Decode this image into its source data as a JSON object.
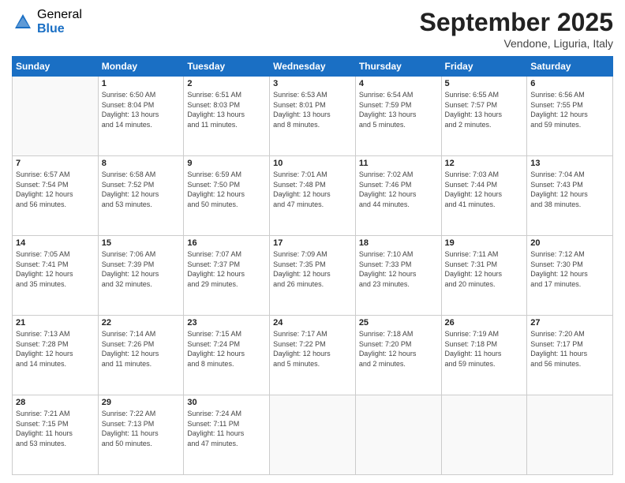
{
  "header": {
    "logo_general": "General",
    "logo_blue": "Blue",
    "month_title": "September 2025",
    "location": "Vendone, Liguria, Italy"
  },
  "days_of_week": [
    "Sunday",
    "Monday",
    "Tuesday",
    "Wednesday",
    "Thursday",
    "Friday",
    "Saturday"
  ],
  "weeks": [
    [
      {
        "day": "",
        "info": ""
      },
      {
        "day": "1",
        "info": "Sunrise: 6:50 AM\nSunset: 8:04 PM\nDaylight: 13 hours\nand 14 minutes."
      },
      {
        "day": "2",
        "info": "Sunrise: 6:51 AM\nSunset: 8:03 PM\nDaylight: 13 hours\nand 11 minutes."
      },
      {
        "day": "3",
        "info": "Sunrise: 6:53 AM\nSunset: 8:01 PM\nDaylight: 13 hours\nand 8 minutes."
      },
      {
        "day": "4",
        "info": "Sunrise: 6:54 AM\nSunset: 7:59 PM\nDaylight: 13 hours\nand 5 minutes."
      },
      {
        "day": "5",
        "info": "Sunrise: 6:55 AM\nSunset: 7:57 PM\nDaylight: 13 hours\nand 2 minutes."
      },
      {
        "day": "6",
        "info": "Sunrise: 6:56 AM\nSunset: 7:55 PM\nDaylight: 12 hours\nand 59 minutes."
      }
    ],
    [
      {
        "day": "7",
        "info": "Sunrise: 6:57 AM\nSunset: 7:54 PM\nDaylight: 12 hours\nand 56 minutes."
      },
      {
        "day": "8",
        "info": "Sunrise: 6:58 AM\nSunset: 7:52 PM\nDaylight: 12 hours\nand 53 minutes."
      },
      {
        "day": "9",
        "info": "Sunrise: 6:59 AM\nSunset: 7:50 PM\nDaylight: 12 hours\nand 50 minutes."
      },
      {
        "day": "10",
        "info": "Sunrise: 7:01 AM\nSunset: 7:48 PM\nDaylight: 12 hours\nand 47 minutes."
      },
      {
        "day": "11",
        "info": "Sunrise: 7:02 AM\nSunset: 7:46 PM\nDaylight: 12 hours\nand 44 minutes."
      },
      {
        "day": "12",
        "info": "Sunrise: 7:03 AM\nSunset: 7:44 PM\nDaylight: 12 hours\nand 41 minutes."
      },
      {
        "day": "13",
        "info": "Sunrise: 7:04 AM\nSunset: 7:43 PM\nDaylight: 12 hours\nand 38 minutes."
      }
    ],
    [
      {
        "day": "14",
        "info": "Sunrise: 7:05 AM\nSunset: 7:41 PM\nDaylight: 12 hours\nand 35 minutes."
      },
      {
        "day": "15",
        "info": "Sunrise: 7:06 AM\nSunset: 7:39 PM\nDaylight: 12 hours\nand 32 minutes."
      },
      {
        "day": "16",
        "info": "Sunrise: 7:07 AM\nSunset: 7:37 PM\nDaylight: 12 hours\nand 29 minutes."
      },
      {
        "day": "17",
        "info": "Sunrise: 7:09 AM\nSunset: 7:35 PM\nDaylight: 12 hours\nand 26 minutes."
      },
      {
        "day": "18",
        "info": "Sunrise: 7:10 AM\nSunset: 7:33 PM\nDaylight: 12 hours\nand 23 minutes."
      },
      {
        "day": "19",
        "info": "Sunrise: 7:11 AM\nSunset: 7:31 PM\nDaylight: 12 hours\nand 20 minutes."
      },
      {
        "day": "20",
        "info": "Sunrise: 7:12 AM\nSunset: 7:30 PM\nDaylight: 12 hours\nand 17 minutes."
      }
    ],
    [
      {
        "day": "21",
        "info": "Sunrise: 7:13 AM\nSunset: 7:28 PM\nDaylight: 12 hours\nand 14 minutes."
      },
      {
        "day": "22",
        "info": "Sunrise: 7:14 AM\nSunset: 7:26 PM\nDaylight: 12 hours\nand 11 minutes."
      },
      {
        "day": "23",
        "info": "Sunrise: 7:15 AM\nSunset: 7:24 PM\nDaylight: 12 hours\nand 8 minutes."
      },
      {
        "day": "24",
        "info": "Sunrise: 7:17 AM\nSunset: 7:22 PM\nDaylight: 12 hours\nand 5 minutes."
      },
      {
        "day": "25",
        "info": "Sunrise: 7:18 AM\nSunset: 7:20 PM\nDaylight: 12 hours\nand 2 minutes."
      },
      {
        "day": "26",
        "info": "Sunrise: 7:19 AM\nSunset: 7:18 PM\nDaylight: 11 hours\nand 59 minutes."
      },
      {
        "day": "27",
        "info": "Sunrise: 7:20 AM\nSunset: 7:17 PM\nDaylight: 11 hours\nand 56 minutes."
      }
    ],
    [
      {
        "day": "28",
        "info": "Sunrise: 7:21 AM\nSunset: 7:15 PM\nDaylight: 11 hours\nand 53 minutes."
      },
      {
        "day": "29",
        "info": "Sunrise: 7:22 AM\nSunset: 7:13 PM\nDaylight: 11 hours\nand 50 minutes."
      },
      {
        "day": "30",
        "info": "Sunrise: 7:24 AM\nSunset: 7:11 PM\nDaylight: 11 hours\nand 47 minutes."
      },
      {
        "day": "",
        "info": ""
      },
      {
        "day": "",
        "info": ""
      },
      {
        "day": "",
        "info": ""
      },
      {
        "day": "",
        "info": ""
      }
    ]
  ]
}
